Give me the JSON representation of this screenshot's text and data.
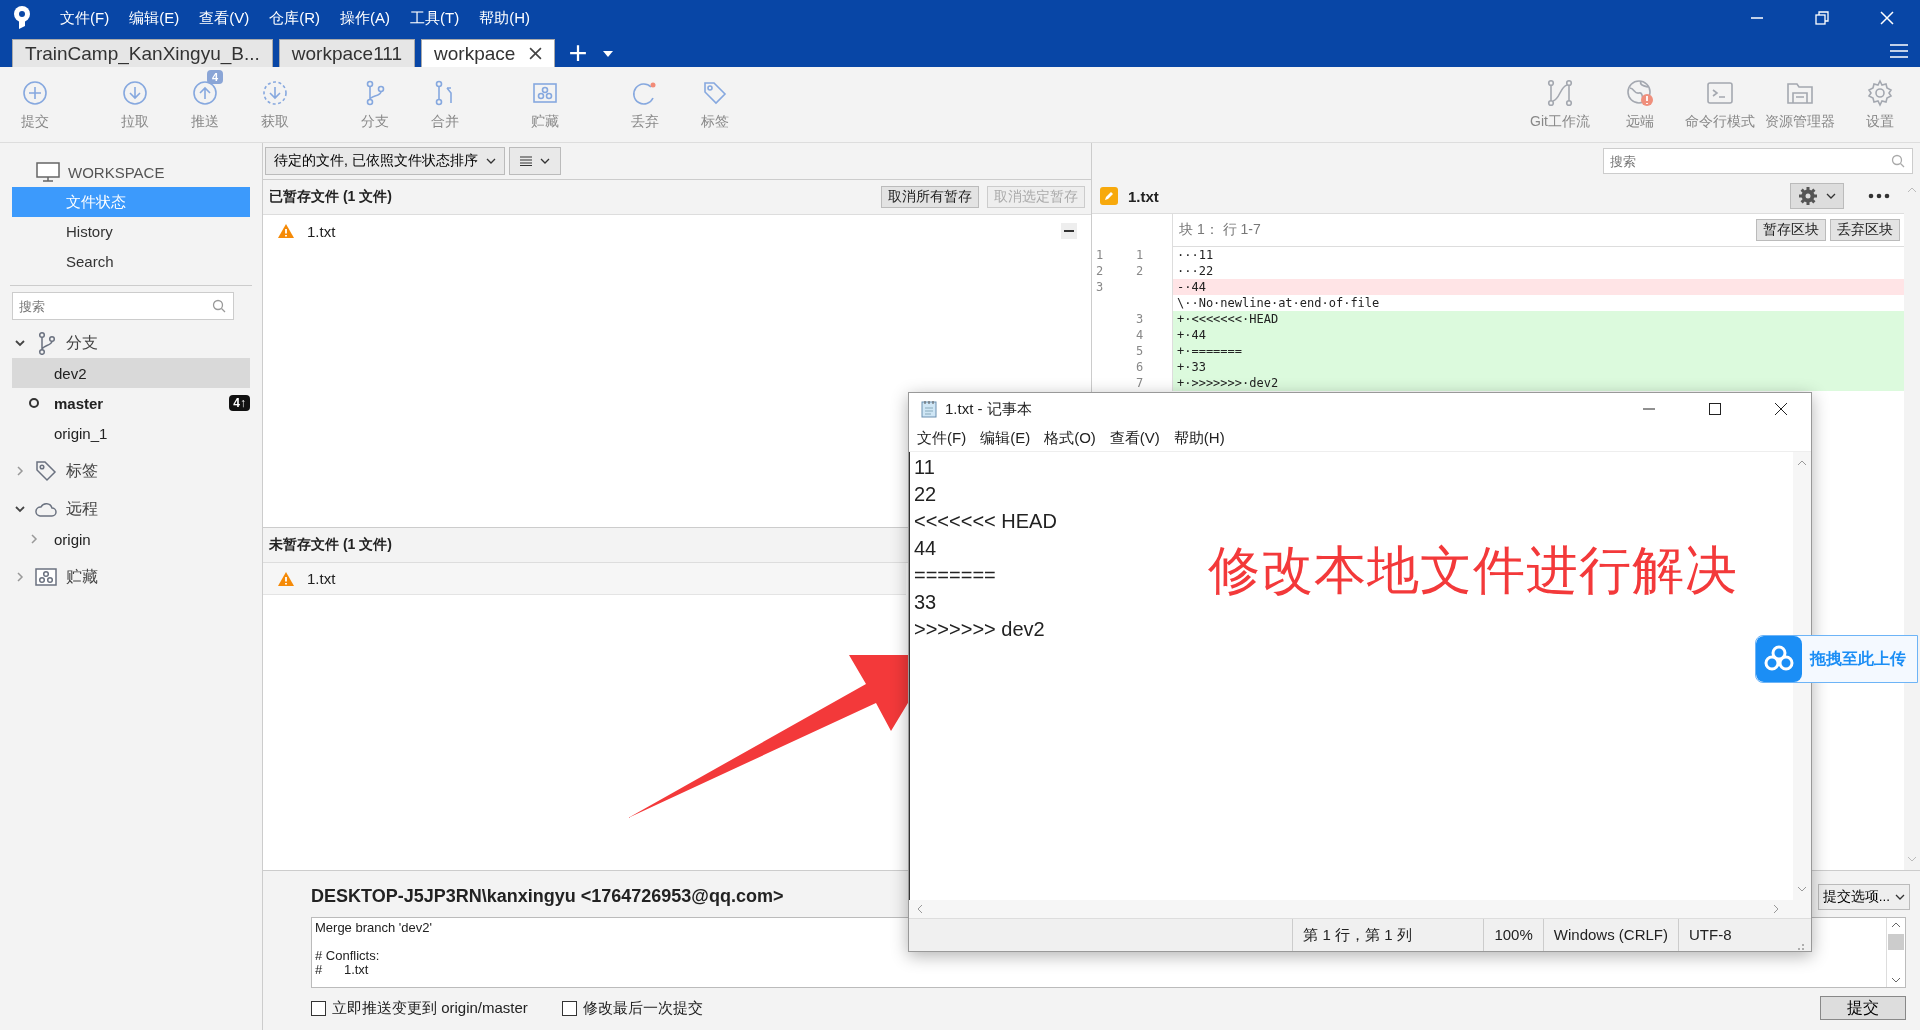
{
  "app_menu": [
    "文件(F)",
    "编辑(E)",
    "查看(V)",
    "仓库(R)",
    "操作(A)",
    "工具(T)",
    "帮助(H)"
  ],
  "repo_tabs": [
    {
      "label": "TrainCamp_KanXingyu_B...",
      "selected": false
    },
    {
      "label": "workpace111",
      "selected": false
    },
    {
      "label": "workpace",
      "selected": true
    }
  ],
  "toolbar_left": [
    {
      "label": "提交",
      "kind": "commit"
    },
    {
      "label": "拉取",
      "kind": "pull"
    },
    {
      "label": "推送",
      "kind": "push",
      "badge": "4"
    },
    {
      "label": "获取",
      "kind": "fetch"
    },
    {
      "label": "分支",
      "kind": "branch"
    },
    {
      "label": "合并",
      "kind": "merge"
    },
    {
      "label": "贮藏",
      "kind": "stash"
    },
    {
      "label": "丢弃",
      "kind": "discard"
    },
    {
      "label": "标签",
      "kind": "tag"
    }
  ],
  "toolbar_right": [
    {
      "label": "Git工作流",
      "kind": "gitflow"
    },
    {
      "label": "远端",
      "kind": "remote"
    },
    {
      "label": "命令行模式",
      "kind": "terminal"
    },
    {
      "label": "资源管理器",
      "kind": "explorer"
    },
    {
      "label": "设置",
      "kind": "settings"
    }
  ],
  "sidebar": {
    "workspace_title": "WORKSPACE",
    "views": [
      {
        "label": "文件状态",
        "selected": true
      },
      {
        "label": "History",
        "selected": false
      },
      {
        "label": "Search",
        "selected": false
      }
    ],
    "search_placeholder": "搜索",
    "sections": [
      {
        "label": "分支",
        "kind": "branch",
        "expanded": true,
        "items": [
          {
            "label": "dev2",
            "selected": true,
            "current": false
          },
          {
            "label": "master",
            "selected": false,
            "current": true,
            "badge": "4↑"
          },
          {
            "label": "origin_1",
            "selected": false,
            "current": false
          }
        ]
      },
      {
        "label": "标签",
        "kind": "tag",
        "expanded": false
      },
      {
        "label": "远程",
        "kind": "remote",
        "expanded": true,
        "items": [
          {
            "label": "origin",
            "selected": false,
            "expanded": false
          }
        ]
      },
      {
        "label": "贮藏",
        "kind": "stash",
        "expanded": false
      }
    ]
  },
  "file_panel": {
    "filter_dropdown": "待定的文件, 已依照文件状态排序",
    "staged": {
      "title": "已暂存文件 (1 文件)",
      "buttons": [
        {
          "label": "取消所有暂存",
          "disabled": false
        },
        {
          "label": "取消选定暂存",
          "disabled": true
        }
      ],
      "files": [
        {
          "name": "1.txt",
          "kind": "conflict"
        }
      ]
    },
    "unstaged": {
      "title": "未暂存文件 (1 文件)",
      "files": [
        {
          "name": "1.txt",
          "kind": "conflict"
        }
      ]
    }
  },
  "diff": {
    "search_placeholder": "搜索",
    "file": "1.txt",
    "hunk": "块 1： 行 1-7",
    "hunk_buttons": [
      "暂存区块",
      "丢弃区块"
    ],
    "lines": [
      {
        "old": "1",
        "new": "1",
        "kind": "context",
        "text": "···11"
      },
      {
        "old": "2",
        "new": "2",
        "kind": "context",
        "text": "···22"
      },
      {
        "old": "3",
        "kind": "removed",
        "text": "-·44"
      },
      {
        "kind": "context",
        "text": "\\··No·newline·at·end·of·file"
      },
      {
        "new": "3",
        "kind": "added",
        "text": "+·<<<<<<<·HEAD"
      },
      {
        "new": "4",
        "kind": "added",
        "text": "+·44"
      },
      {
        "new": "5",
        "kind": "added",
        "text": "+·======="
      },
      {
        "new": "6",
        "kind": "added",
        "text": "+·33"
      },
      {
        "new": "7",
        "kind": "added",
        "text": "+·>>>>>>>·dev2"
      }
    ]
  },
  "commit": {
    "author": "DESKTOP-J5JP3RN\\kanxingyu <1764726953@qq.com>",
    "options": "提交选项...",
    "message": "Merge branch 'dev2'\n\n# Conflicts:\n#\t1.txt",
    "checkboxes": [
      {
        "label": "立即推送变更到 origin/master",
        "checked": false
      },
      {
        "label": "修改最后一次提交",
        "checked": false
      }
    ],
    "submit": "提交"
  },
  "notepad": {
    "title": "1.txt - 记事本",
    "menu": [
      "文件(F)",
      "编辑(E)",
      "格式(O)",
      "查看(V)",
      "帮助(H)"
    ],
    "lines": [
      "11",
      "22",
      "<<<<<<< HEAD",
      "44",
      "=======",
      "33",
      ">>>>>>> dev2"
    ],
    "status": [
      "第 1 行，第 1 列",
      "100%",
      "Windows (CRLF)",
      "UTF-8"
    ]
  },
  "annotation": {
    "text": "修改本地文件进行解决"
  },
  "upload_widget": {
    "label": "拖拽至此上传"
  }
}
